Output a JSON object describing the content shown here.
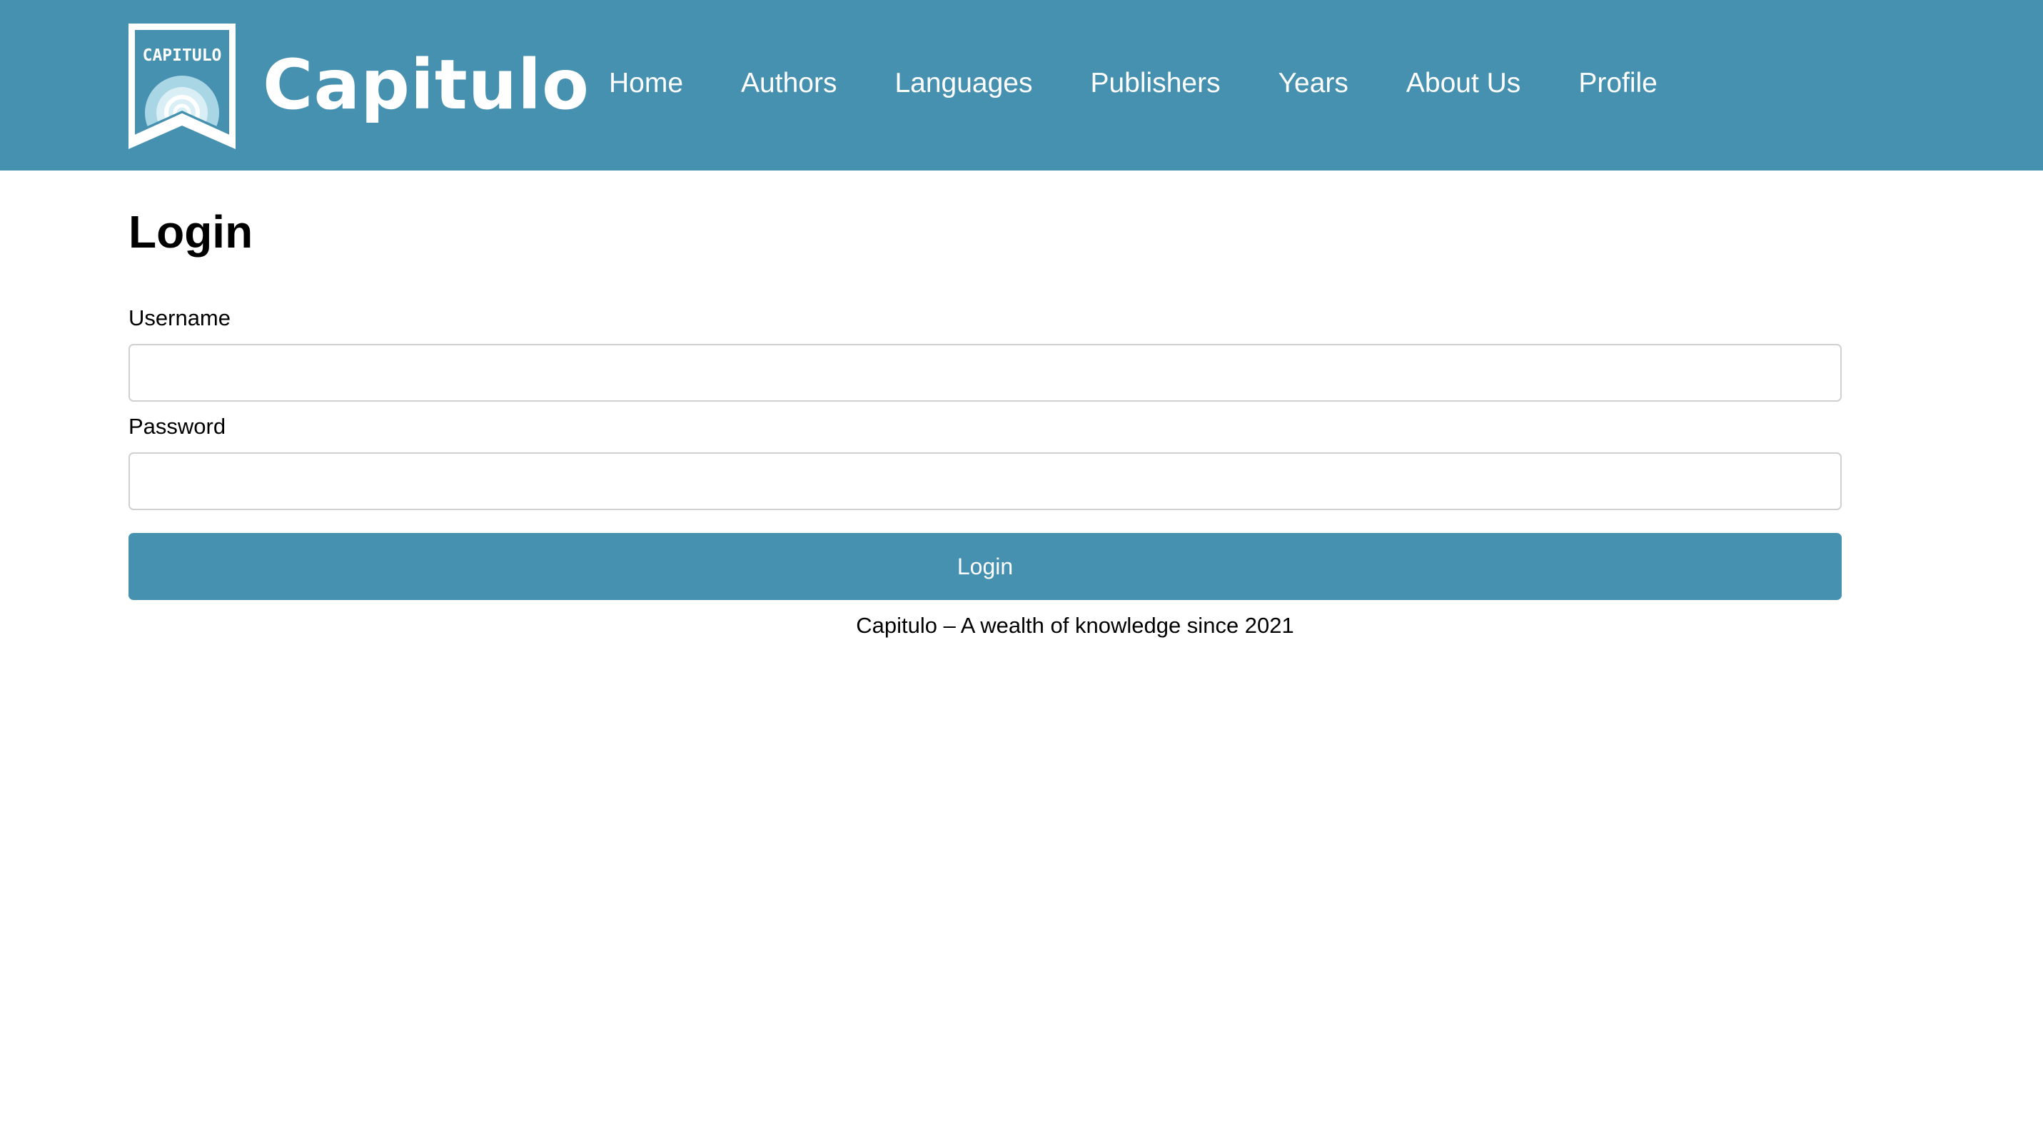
{
  "header": {
    "logo_text": "CAPITULO",
    "brand": "Capitulo",
    "background_color": "#4690b0",
    "nav": [
      {
        "label": "Home"
      },
      {
        "label": "Authors"
      },
      {
        "label": "Languages"
      },
      {
        "label": "Publishers"
      },
      {
        "label": "Years"
      },
      {
        "label": "About Us"
      },
      {
        "label": "Profile"
      }
    ]
  },
  "main": {
    "title": "Login",
    "username_label": "Username",
    "username_value": "",
    "password_label": "Password",
    "password_value": "",
    "submit_label": "Login",
    "accent_color": "#4690b0"
  },
  "footer": {
    "text": "Capitulo – A wealth of knowledge since 2021"
  }
}
